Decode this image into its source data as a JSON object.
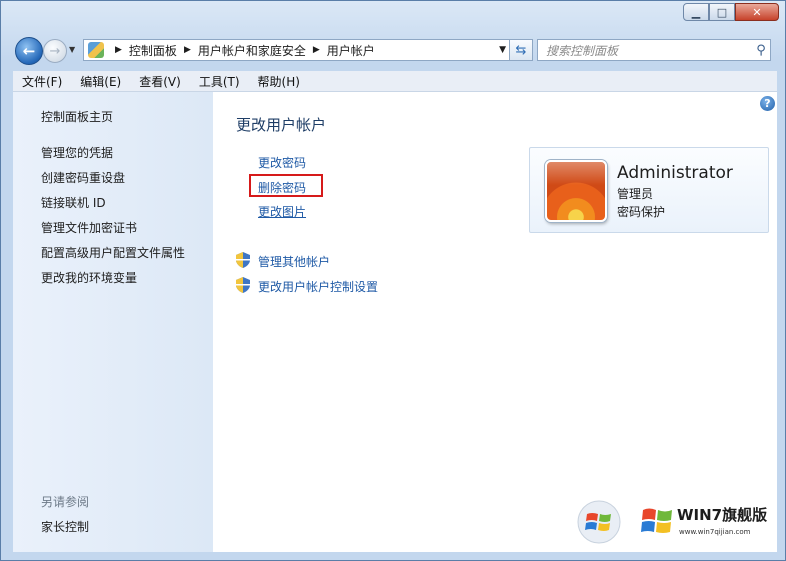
{
  "window": {
    "minimize_icon": "minimize-icon",
    "maximize_icon": "maximize-icon",
    "close_icon": "close-icon"
  },
  "nav": {
    "back_icon": "back-arrow-icon",
    "forward_icon": "forward-arrow-icon",
    "breadcrumb": [
      "控制面板",
      "用户帐户和家庭安全",
      "用户帐户"
    ],
    "refresh_icon": "refresh-icon",
    "search_placeholder": "搜索控制面板"
  },
  "menu": [
    "文件(F)",
    "编辑(E)",
    "查看(V)",
    "工具(T)",
    "帮助(H)"
  ],
  "sidebar": {
    "home": "控制面板主页",
    "items": [
      "管理您的凭据",
      "创建密码重设盘",
      "链接联机 ID",
      "管理文件加密证书",
      "配置高级用户配置文件属性",
      "更改我的环境变量"
    ],
    "see_also_heading": "另请参阅",
    "see_also_items": [
      "家长控制"
    ]
  },
  "main": {
    "title": "更改用户帐户",
    "links": [
      "更改密码",
      "删除密码",
      "更改图片"
    ],
    "highlighted_link": "删除密码",
    "shield_links": [
      "管理其他帐户",
      "更改用户帐户控制设置"
    ]
  },
  "user": {
    "name": "Administrator",
    "role": "管理员",
    "protection": "密码保护"
  },
  "watermark": {
    "brand": "WIN7旗舰版",
    "url": "www.win7qijian.com"
  },
  "colors": {
    "link": "#1f5aa6",
    "highlight_box": "#d61a1a",
    "close_button": "#c7422a"
  }
}
